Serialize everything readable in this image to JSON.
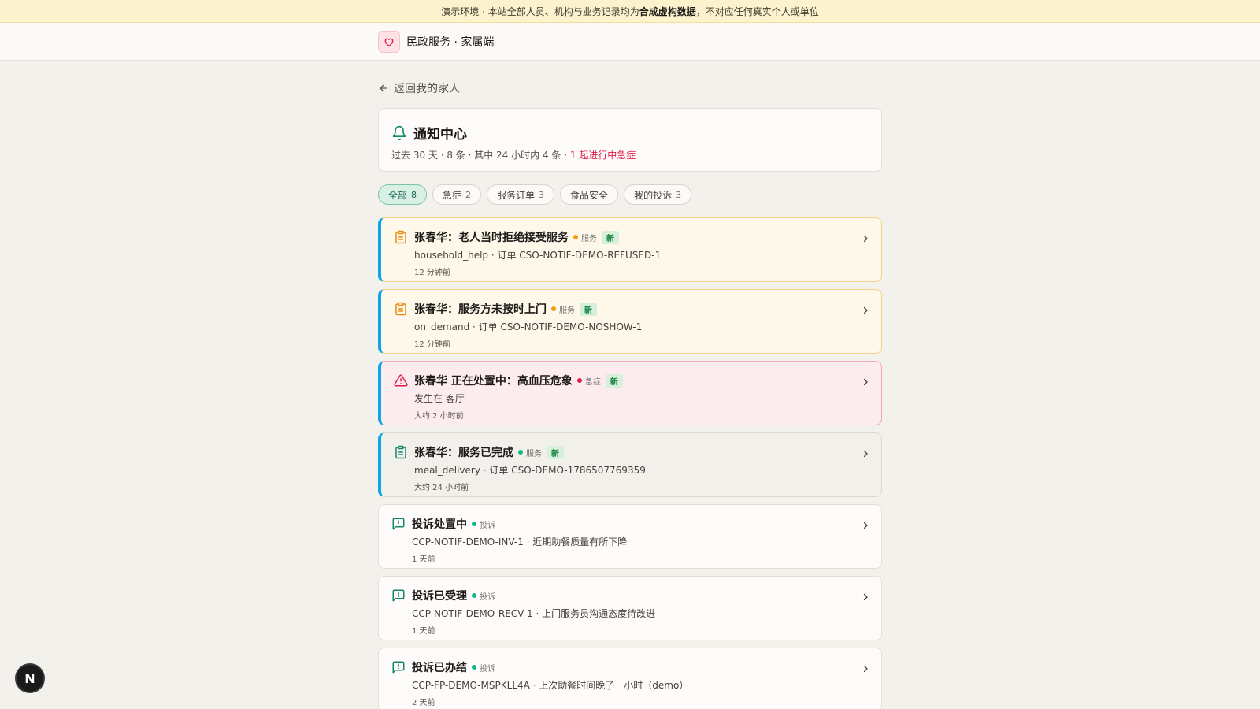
{
  "banner": {
    "prefix": "演示环境 · 本站全部人员、机构与业务记录均为",
    "bold": "合成虚构数据",
    "suffix": "，不对应任何真实个人或单位"
  },
  "app": {
    "title": "民政服务 · 家属端",
    "logo_icon": "heart-icon"
  },
  "back_label": "返回我的家人",
  "header": {
    "title": "通知中心",
    "summary": "过去 30 天 · 8 条 · 其中 24 小时内 4 条 · ",
    "urgent_summary": "1 起进行中急症"
  },
  "filters": [
    {
      "label": "全部",
      "count": "8",
      "active": true
    },
    {
      "label": "急症",
      "count": "2",
      "active": false
    },
    {
      "label": "服务订单",
      "count": "3",
      "active": false
    },
    {
      "label": "食品安全",
      "count": "",
      "active": false
    },
    {
      "label": "我的投诉",
      "count": "3",
      "active": false
    }
  ],
  "notifications": [
    {
      "title": "张春华：老人当时拒绝接受服务",
      "tag": "服务",
      "new_badge": "新",
      "detail": "household_help · 订单 CSO-NOTIF-DEMO-REFUSED-1",
      "time": "12 分钟前"
    },
    {
      "title": "张春华：服务方未按时上门",
      "tag": "服务",
      "new_badge": "新",
      "detail": "on_demand · 订单 CSO-NOTIF-DEMO-NOSHOW-1",
      "time": "12 分钟前"
    },
    {
      "title": "张春华 正在处置中：高血压危象",
      "tag": "急症",
      "new_badge": "新",
      "detail": "发生在 客厅",
      "time": "大约 2 小时前"
    },
    {
      "title": "张春华：服务已完成",
      "tag": "服务",
      "new_badge": "新",
      "detail": "meal_delivery · 订单 CSO-DEMO-1786507769359",
      "time": "大约 24 小时前"
    },
    {
      "title": "投诉处置中",
      "tag": "投诉",
      "detail": "CCP-NOTIF-DEMO-INV-1 · 近期助餐质量有所下降",
      "time": "1 天前"
    },
    {
      "title": "投诉已受理",
      "tag": "投诉",
      "detail": "CCP-NOTIF-DEMO-RECV-1 · 上门服务员沟通态度待改进",
      "time": "1 天前"
    },
    {
      "title": "投诉已办结",
      "tag": "投诉",
      "detail": "CCP-FP-DEMO-MSPKLL4A · 上次助餐时间晚了一小时（demo）",
      "time": "2 天前"
    }
  ],
  "fab_label": "N",
  "colors": {
    "accent_green": "#14664a",
    "urgent_red": "#e11d48",
    "service_orange": "#f59e0b",
    "unread_blue": "#0ea5e9"
  }
}
